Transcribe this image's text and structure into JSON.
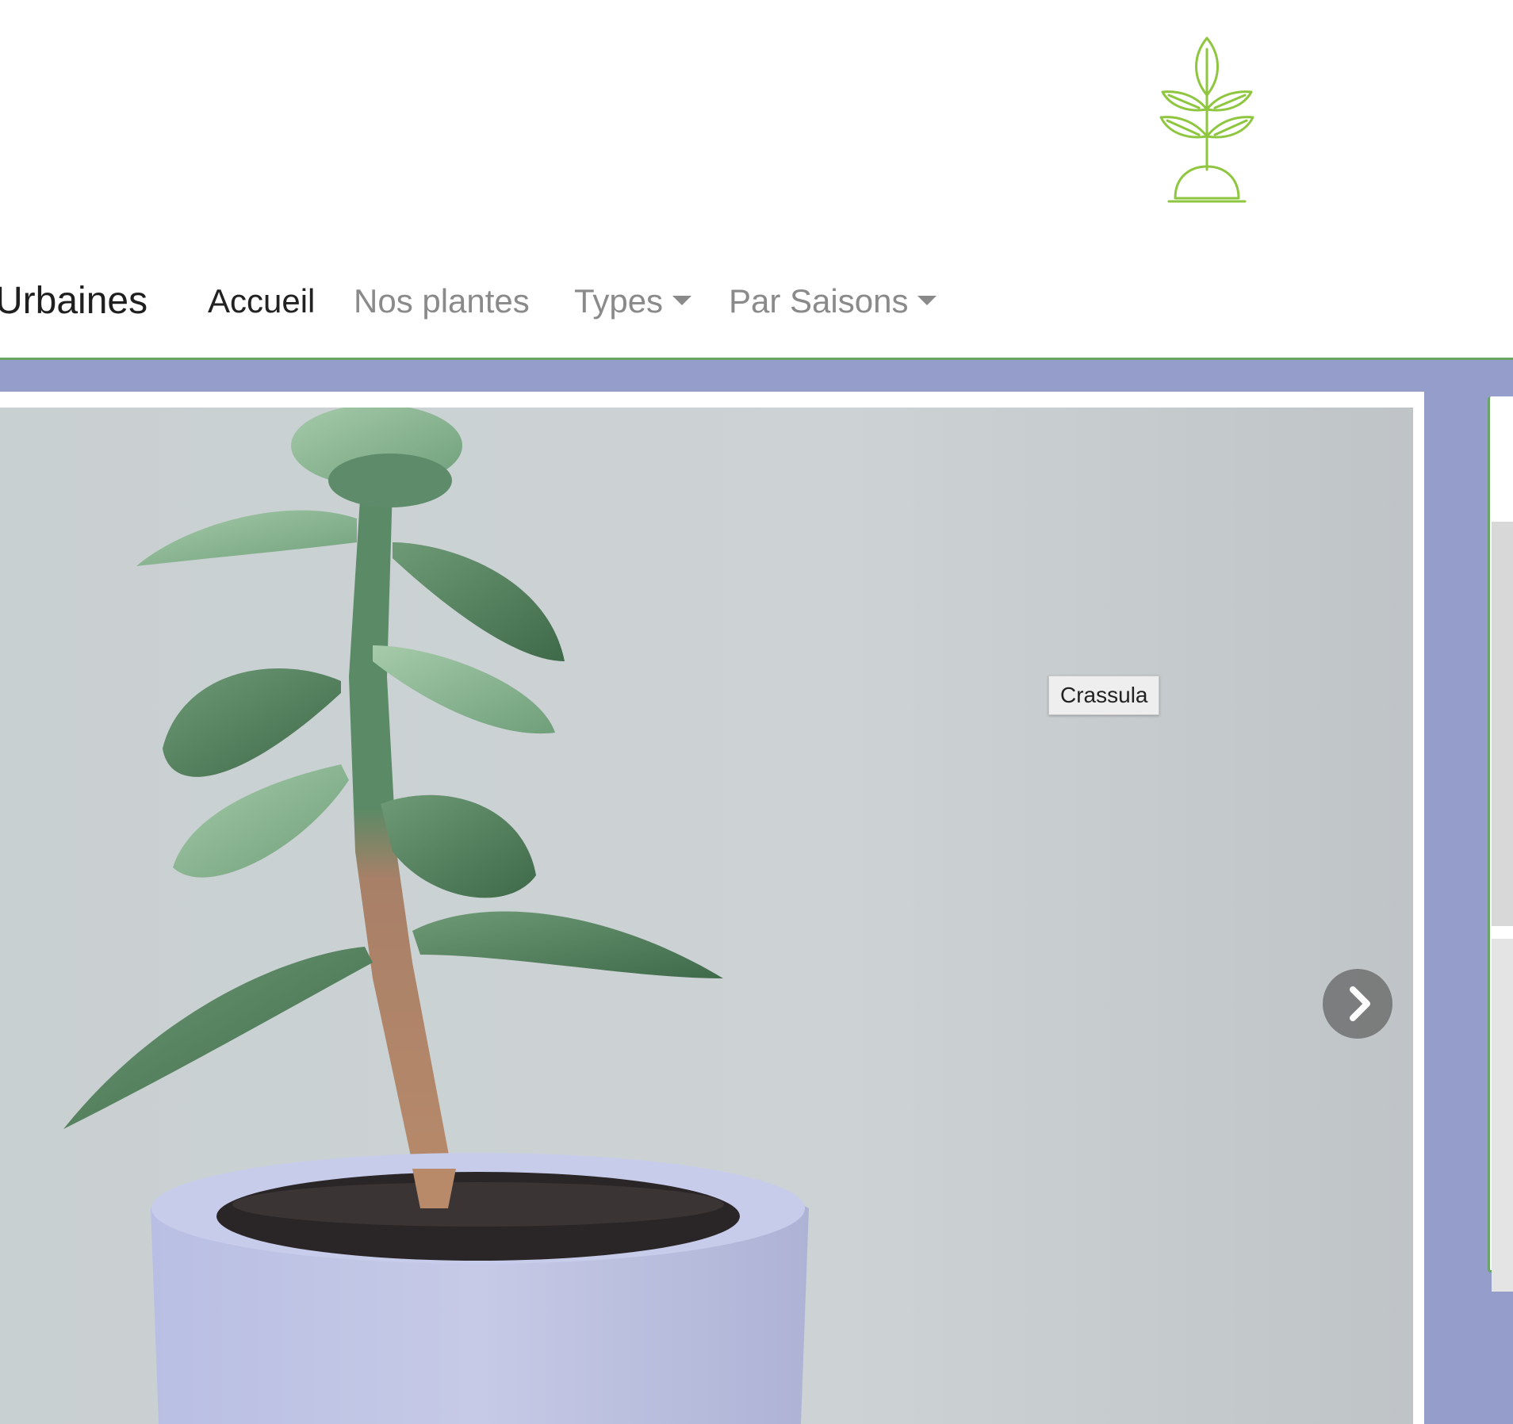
{
  "header": {
    "logo_icon": "plant-sprout-icon"
  },
  "navbar": {
    "brand": "Urbaines",
    "items": [
      {
        "label": "Accueil",
        "active": true
      },
      {
        "label": "Nos plantes",
        "active": false
      },
      {
        "label": "Types",
        "dropdown": true
      },
      {
        "label": "Par Saisons",
        "dropdown": true
      }
    ]
  },
  "slider": {
    "tooltip": "Crassula",
    "next_icon": "chevron-right-icon"
  },
  "colors": {
    "accent_green": "#8ec63f",
    "border_green": "#6aa566",
    "slider_bg": "#959eca"
  }
}
